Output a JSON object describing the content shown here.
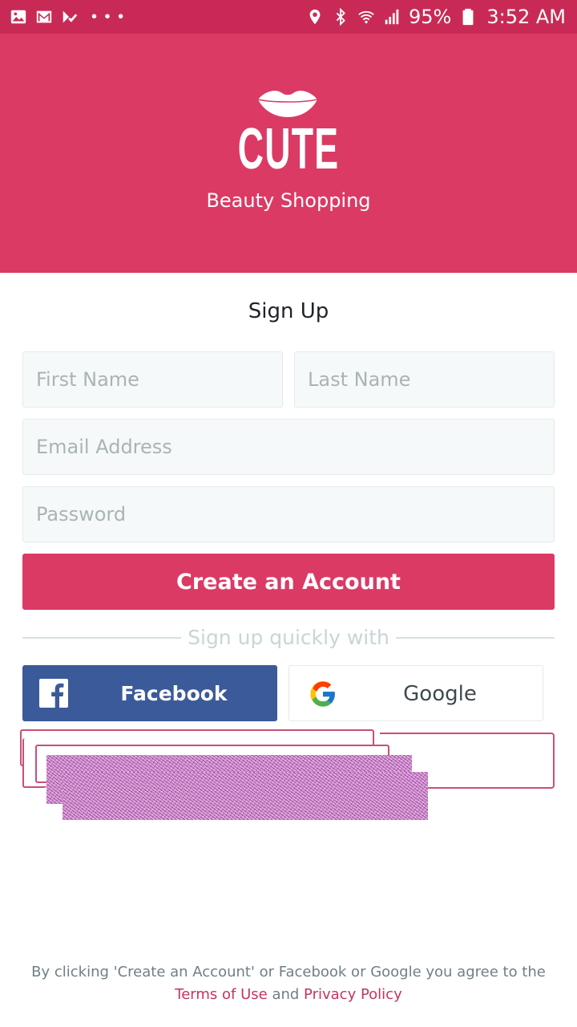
{
  "status_bar": {
    "left_icons": [
      "gallery-icon",
      "gmail-icon",
      "checklist-icon"
    ],
    "more_dots": "• • •",
    "right_icons": [
      "location-icon",
      "bluetooth-icon",
      "wifi-icon",
      "signal-icon"
    ],
    "battery_percent": "95%",
    "time": "3:52 AM"
  },
  "header": {
    "logo_text": "CUTE",
    "tagline": "Beauty Shopping",
    "background_color": "#db3a65"
  },
  "form": {
    "title": "Sign Up",
    "first_name_placeholder": "First Name",
    "last_name_placeholder": "Last Name",
    "email_placeholder": "Email Address",
    "password_placeholder": "Password",
    "create_button_label": "Create an Account",
    "divider_text": "Sign up quickly with"
  },
  "social": {
    "facebook_label": "Facebook",
    "google_label": "Google",
    "facebook_color": "#3b5a9a"
  },
  "footer": {
    "terms_prefix": "By clicking 'Create an Account' or Facebook or Google you agree to the",
    "terms_link": "Terms of Use",
    "and_text": "and",
    "privacy_link": "Privacy Policy"
  }
}
